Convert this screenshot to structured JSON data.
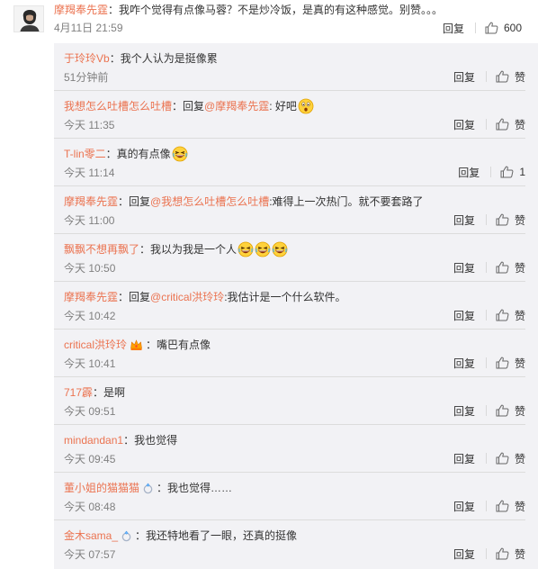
{
  "main_comment": {
    "user": "摩羯奉先霆",
    "text": "：我咋个觉得有点像马蓉？不是炒冷饭，是真的有这种感觉。别赞。。。",
    "time": "4月11日 21:59",
    "reply_label": "回复",
    "likes": "600"
  },
  "replies": [
    {
      "user": "于玲玲Vb",
      "text": "：我个人认为是挺像累",
      "time": "51分钟前",
      "reply_label": "回复",
      "like_label": "赞"
    },
    {
      "user": "我想怎么吐槽怎么吐槽",
      "text_a": "：回复",
      "mention": "@摩羯奉先霆",
      "text_b": ": 好吧",
      "time": "今天 11:35",
      "reply_label": "回复",
      "like_label": "赞"
    },
    {
      "user": "T-lin零二",
      "text": "：真的有点像",
      "time": "今天 11:14",
      "reply_label": "回复",
      "likes": "1"
    },
    {
      "user": "摩羯奉先霆",
      "text_a": "：回复",
      "mention": "@我想怎么吐槽怎么吐槽",
      "text_b": ":难得上一次热门。就不要套路了",
      "time": "今天 11:00",
      "reply_label": "回复",
      "like_label": "赞"
    },
    {
      "user": "飘飘不想再飘了",
      "text": "：我以为我是一个人",
      "time": "今天 10:50",
      "reply_label": "回复",
      "like_label": "赞"
    },
    {
      "user": "摩羯奉先霆",
      "text_a": "：回复",
      "mention": "@critical洪玲玲",
      "text_b": ":我估计是一个什么软件。",
      "time": "今天 10:42",
      "reply_label": "回复",
      "like_label": "赞"
    },
    {
      "user": "critical洪玲玲",
      "text": "：嘴巴有点像",
      "time": "今天 10:41",
      "reply_label": "回复",
      "like_label": "赞"
    },
    {
      "user": "717霹",
      "text": "：是啊",
      "time": "今天 09:51",
      "reply_label": "回复",
      "like_label": "赞"
    },
    {
      "user": "mindandan1",
      "text": "：我也觉得",
      "time": "今天 09:45",
      "reply_label": "回复",
      "like_label": "赞"
    },
    {
      "user": "董小姐的猫猫猫",
      "text": "：我也觉得……",
      "time": "今天 08:48",
      "reply_label": "回复",
      "like_label": "赞"
    },
    {
      "user": "金木sama_",
      "text": "：我还特地看了一眼，还真的挺像",
      "time": "今天 07:57",
      "reply_label": "回复",
      "like_label": "赞"
    }
  ],
  "icons": {
    "thumb": "thumbs-up-icon",
    "emoji_surprised": "surprised-emoji",
    "emoji_laugh": "laughing-emoji",
    "badge_crown": "crown-badge-icon",
    "badge_ring": "ring-badge-icon"
  },
  "colors": {
    "username": "#eb7350",
    "text": "#333333",
    "meta": "#808080",
    "panel_bg": "#f2f2f5"
  }
}
